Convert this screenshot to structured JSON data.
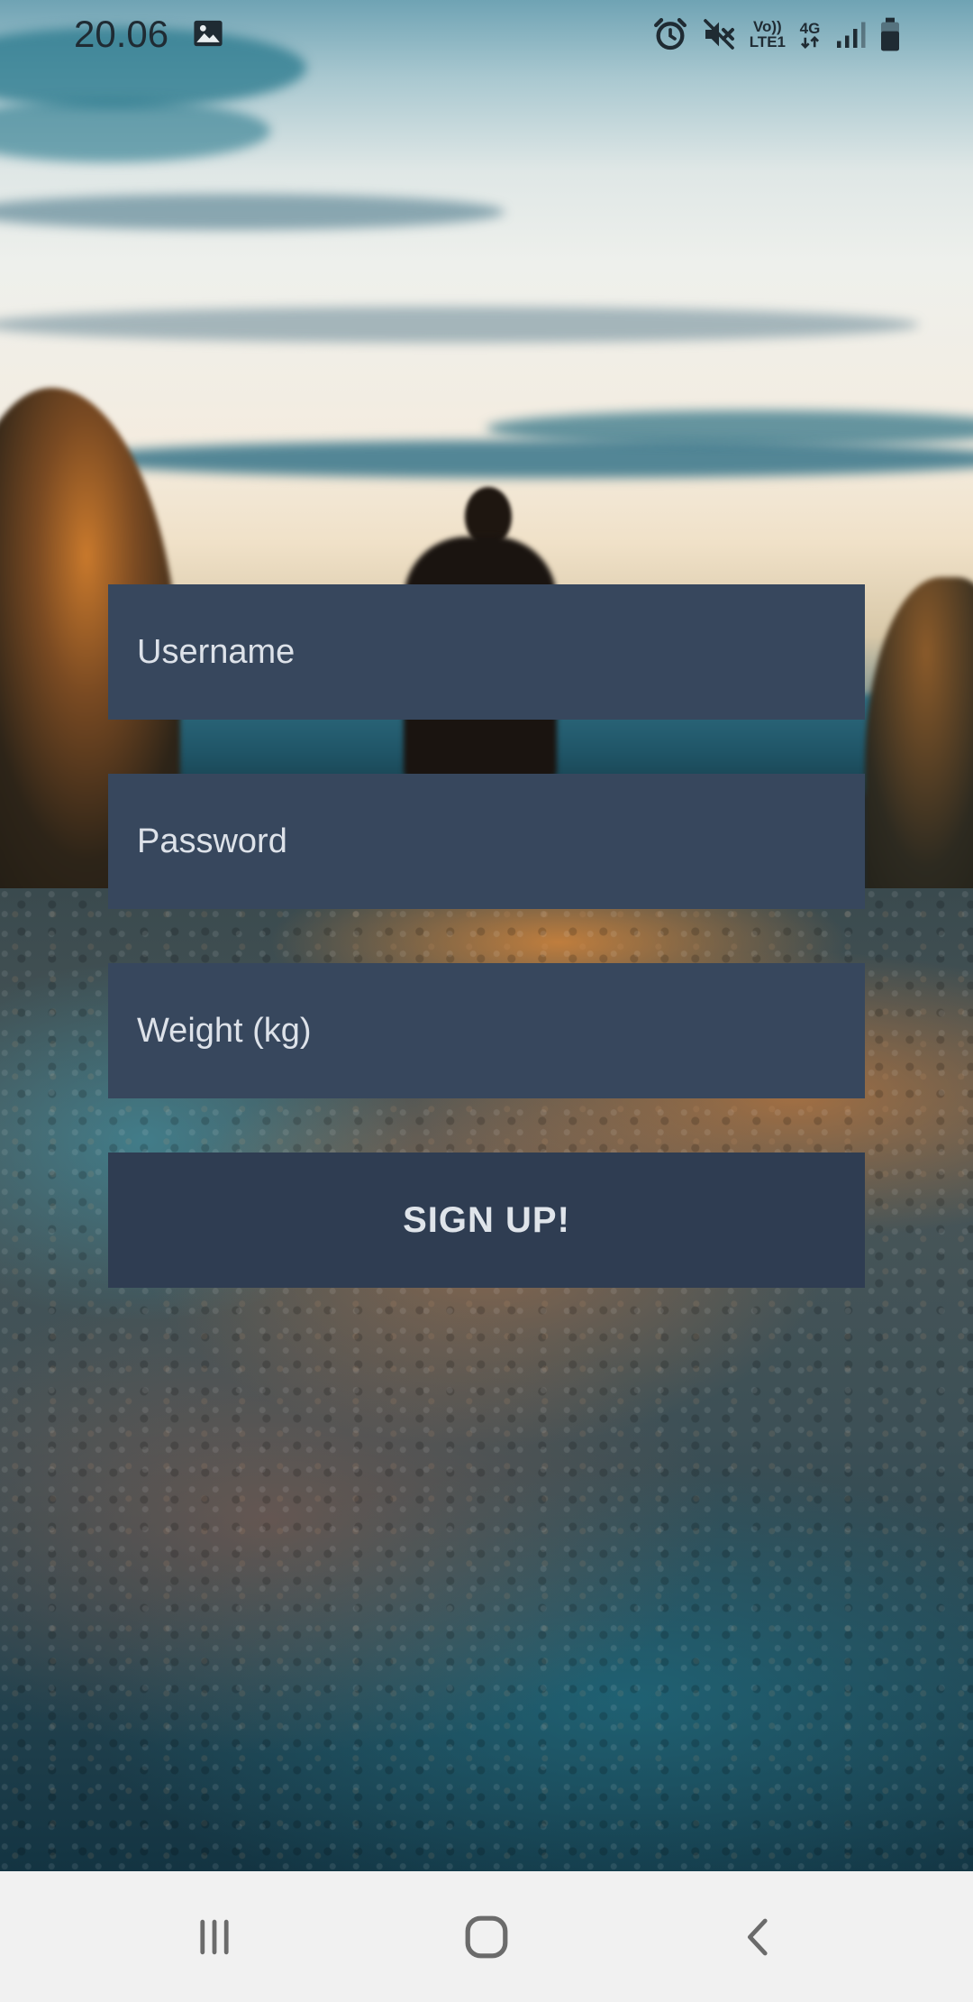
{
  "status_bar": {
    "time": "20.06",
    "network_line1": "Vo))",
    "network_line2": "LTE1",
    "network_type": "4G",
    "icons": [
      "gallery-icon",
      "alarm-icon",
      "mute-icon",
      "volte-icon",
      "4g-data-icon",
      "signal-icon",
      "battery-icon"
    ]
  },
  "form": {
    "username_placeholder": "Username",
    "password_placeholder": "Password",
    "weight_placeholder": "Weight (kg)",
    "signup_label": "SIGN UP!"
  },
  "nav_bar": {
    "icons": [
      "recent-apps-icon",
      "home-icon",
      "back-icon"
    ]
  },
  "colors": {
    "field_background": "#37475d",
    "button_background": "#2f3d52",
    "field_text": "#dde2e9",
    "nav_background": "#f1f1f1",
    "nav_icon": "#6b6b6b"
  }
}
